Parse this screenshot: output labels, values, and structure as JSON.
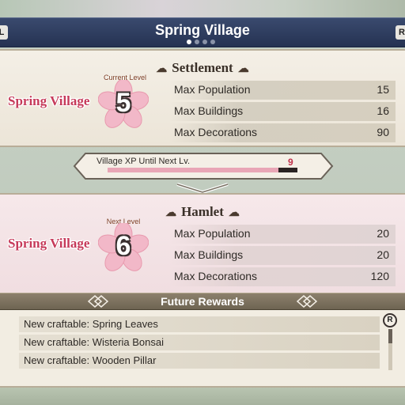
{
  "header": {
    "title": "Spring Village",
    "left_key": "L",
    "right_key": "R",
    "page_count": 4,
    "active_page": 1
  },
  "current": {
    "village_name": "Spring Village",
    "level_label": "Current Level",
    "level": "5",
    "rank": "Settlement",
    "stats": [
      {
        "label": "Max Population",
        "value": "15"
      },
      {
        "label": "Max Buildings",
        "value": "16"
      },
      {
        "label": "Max Decorations",
        "value": "90"
      }
    ]
  },
  "xp": {
    "label": "Village XP Until Next Lv.",
    "remaining": "9",
    "progress": 0.9
  },
  "next": {
    "village_name": "Spring Village",
    "level_label": "Next Level",
    "level": "6",
    "rank": "Hamlet",
    "stats": [
      {
        "label": "Max Population",
        "value": "20"
      },
      {
        "label": "Max Buildings",
        "value": "20"
      },
      {
        "label": "Max Decorations",
        "value": "120"
      }
    ]
  },
  "rewards": {
    "title": "Future Rewards",
    "scroll_key": "R",
    "items": [
      "New craftable: Spring Leaves",
      "New craftable: Wisteria Bonsai",
      "New craftable: Wooden Pillar"
    ]
  },
  "colors": {
    "title_bar": "#253252",
    "village_name": "#c63a5a",
    "flower": "#f2b8c8",
    "xp_fill": "#e9a6b6",
    "xp_remaining": "#c0304a"
  },
  "icons": [
    "cloud-ornament-icon",
    "sakura-flower-icon",
    "chevron-down-icon",
    "diamond-ornament-icon"
  ]
}
